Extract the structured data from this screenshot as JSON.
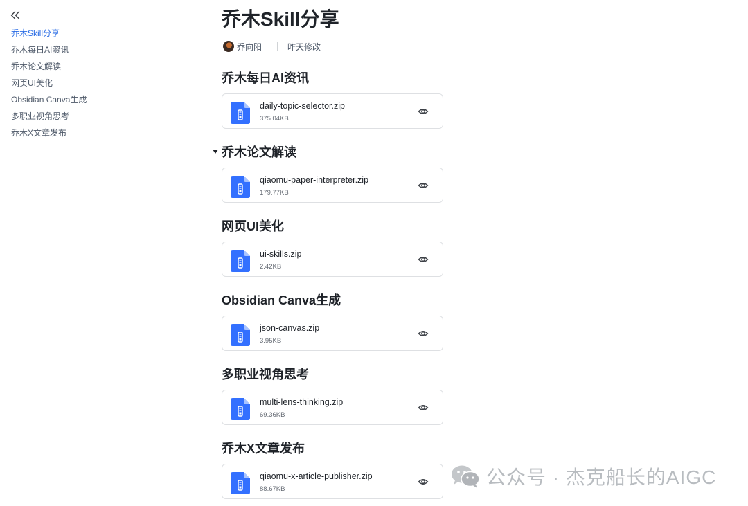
{
  "sidebar": {
    "items": [
      {
        "label": "乔木Skill分享",
        "active": true
      },
      {
        "label": "乔木每日AI资讯",
        "active": false
      },
      {
        "label": "乔木论文解读",
        "active": false
      },
      {
        "label": "网页UI美化",
        "active": false
      },
      {
        "label": "Obsidian Canva生成",
        "active": false
      },
      {
        "label": "多职业视角思考",
        "active": false
      },
      {
        "label": "乔木X文章发布",
        "active": false
      }
    ]
  },
  "page": {
    "title": "乔木Skill分享",
    "author": "乔向阳",
    "modified": "昨天修改"
  },
  "sections": [
    {
      "heading": "乔木每日AI资讯",
      "file": {
        "name": "daily-topic-selector.zip",
        "size": "375.04KB"
      }
    },
    {
      "heading": "乔木论文解读",
      "expanded": true,
      "file": {
        "name": "qiaomu-paper-interpreter.zip",
        "size": "179.77KB"
      }
    },
    {
      "heading": "网页UI美化",
      "file": {
        "name": "ui-skills.zip",
        "size": "2.42KB"
      }
    },
    {
      "heading": "Obsidian Canva生成",
      "file": {
        "name": "json-canvas.zip",
        "size": "3.95KB"
      }
    },
    {
      "heading": "多职业视角思考",
      "file": {
        "name": "multi-lens-thinking.zip",
        "size": "69.36KB"
      }
    },
    {
      "heading": "乔木X文章发布",
      "file": {
        "name": "qiaomu-x-article-publisher.zip",
        "size": "88.67KB"
      }
    }
  ],
  "watermark": {
    "text": "公众号 · 杰克船长的AIGC"
  },
  "icons": {
    "collapse": "double-chevron-left-icon",
    "file": "zip-file-icon",
    "preview": "eye-icon",
    "watermark": "wechat-icon"
  },
  "colors": {
    "accent": "#2b6de5",
    "file_icon": "#3370ff",
    "text": "#1f2329",
    "muted": "#646a73"
  }
}
